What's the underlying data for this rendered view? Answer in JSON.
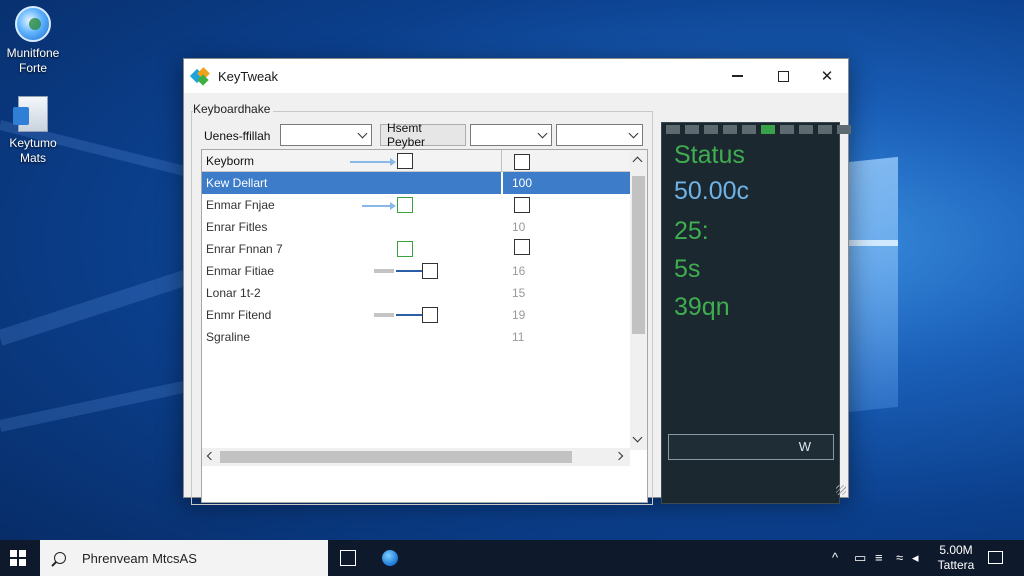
{
  "desktop": {
    "icons": [
      {
        "label": "Munitfone Forte",
        "icon": "globe-icon"
      },
      {
        "label": "Keytumo Mats",
        "icon": "document-icon"
      }
    ]
  },
  "window": {
    "title": "KeyTweak",
    "controls": {
      "minimize": "minimize-icon",
      "maximize": "maximize-icon",
      "close": "close-icon"
    },
    "group_label": "Keyboardhake",
    "toolbar": {
      "label1": "Uenes-ffillah",
      "button": "Hsemt Peyber",
      "combo1_value": "",
      "combo2_value": "",
      "combo3_value": ""
    },
    "list": {
      "header": {
        "col1": "Keyborm",
        "col2": ""
      },
      "rows": [
        {
          "name": "Kew Dellart",
          "value": "100",
          "selected": true
        },
        {
          "name": "Enmar Fnjae",
          "value": "",
          "selected": false
        },
        {
          "name": "Enrar Fitles",
          "value": "10",
          "selected": false
        },
        {
          "name": "Enrar Fnnan 7",
          "value": "",
          "selected": false
        },
        {
          "name": "Enmar Fitiae",
          "value": "16",
          "selected": false
        },
        {
          "name": "Lonar 1t-2",
          "value": "15",
          "selected": false
        },
        {
          "name": "Enmr Fitend",
          "value": "19",
          "selected": false
        },
        {
          "name": "Sgraline",
          "value": "11",
          "selected": false
        }
      ]
    },
    "status": {
      "title": "Status",
      "values": [
        {
          "text": "50.00c",
          "color": "#6fb3e6"
        },
        {
          "text": "25:",
          "color": "#3fae4f"
        },
        {
          "text": "5s",
          "color": "#3fae4f"
        },
        {
          "text": "39qn",
          "color": "#3fae4f"
        }
      ],
      "led_states": [
        false,
        false,
        false,
        false,
        false,
        true,
        false,
        false,
        false,
        false
      ],
      "button_label": "W"
    }
  },
  "taskbar": {
    "search_text": "Phrenveam MtcsAS",
    "clock_time": "5.00M",
    "clock_date": "Tattera"
  }
}
